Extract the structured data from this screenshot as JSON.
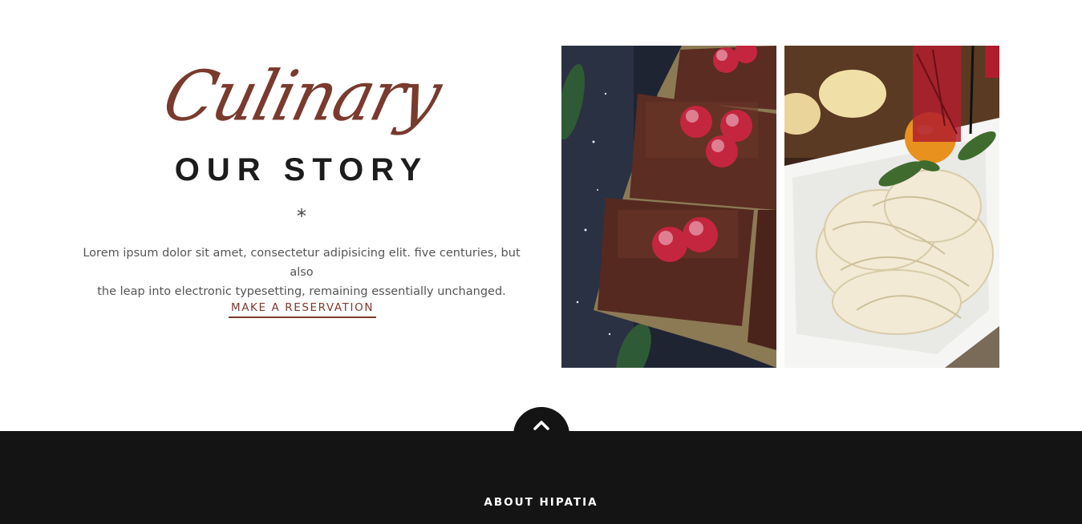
{
  "story": {
    "script_title": "Culinary",
    "title": "OUR STORY",
    "divider_glyph": "*",
    "description_line1": "Lorem ipsum dolor sit amet, consectetur adipisicing elit. five centuries, but also",
    "description_line2": "the leap into electronic typesetting, remaining essentially unchanged.",
    "cta_label": "MAKE A RESERVATION"
  },
  "gallery": {
    "images": [
      {
        "subject": "chocolate brownies with frozen raspberries",
        "icon": "brownie-photo"
      },
      {
        "subject": "pasta with cherry tomato and basil",
        "icon": "pasta-photo"
      }
    ]
  },
  "footer": {
    "scroll_top_icon": "chevron-up-icon",
    "title": "ABOUT HIPATIA"
  },
  "colors": {
    "accent": "#7a3a2e",
    "heading": "#1c1c1c",
    "footer_bg": "#141414",
    "footer_text": "#ffffff"
  }
}
